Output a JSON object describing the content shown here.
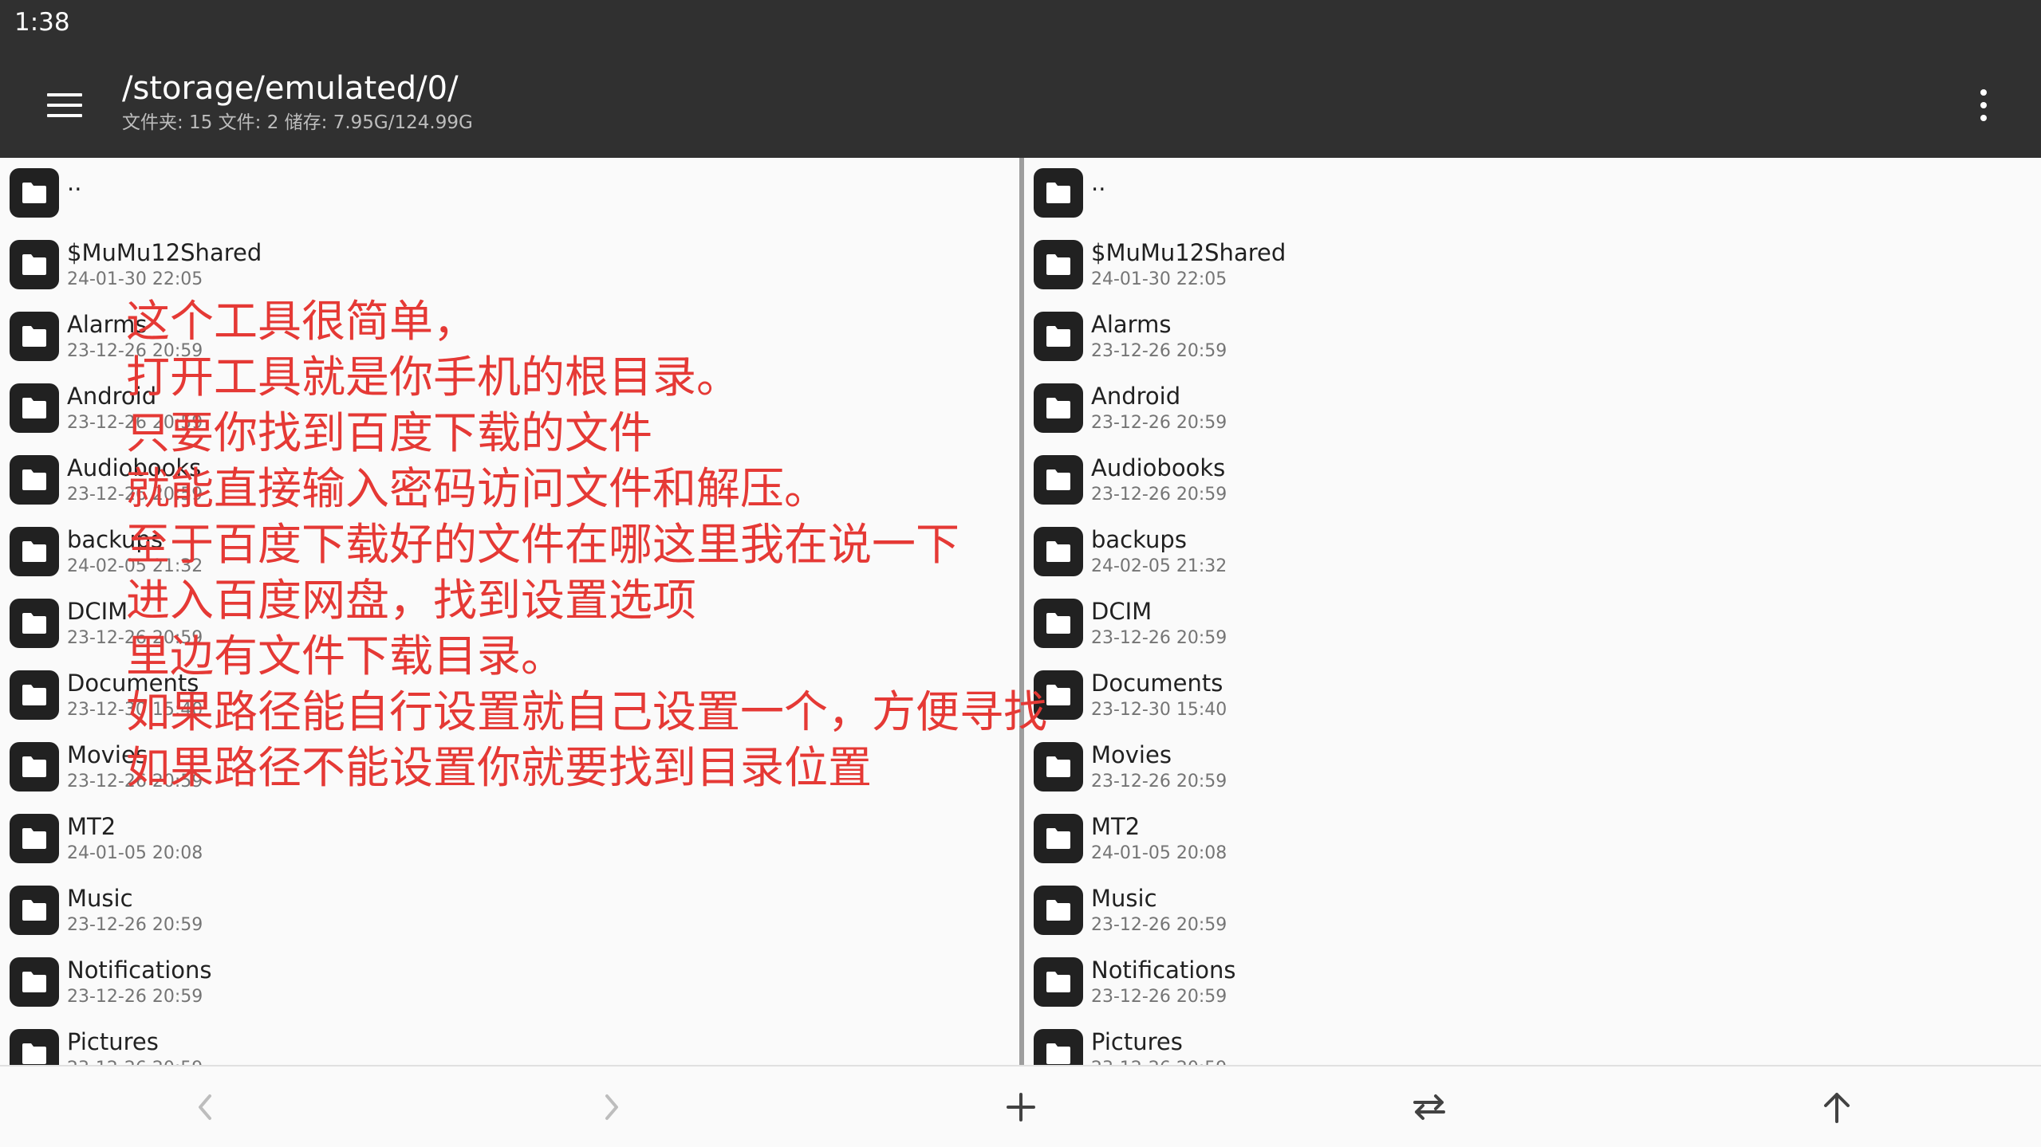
{
  "status_bar": {
    "time": "1:38"
  },
  "toolbar": {
    "path": "/storage/emulated/0/",
    "info": "文件夹: 15  文件: 2  储存: 7.95G/124.99G"
  },
  "left_pane": {
    "up_label": "..",
    "items": [
      {
        "name": "$MuMu12Shared",
        "date": "24-01-30 22:05"
      },
      {
        "name": "Alarms",
        "date": "23-12-26 20:59"
      },
      {
        "name": "Android",
        "date": "23-12-26 20:59"
      },
      {
        "name": "Audiobooks",
        "date": "23-12-26 20:59"
      },
      {
        "name": "backups",
        "date": "24-02-05 21:32"
      },
      {
        "name": "DCIM",
        "date": "23-12-26 20:59"
      },
      {
        "name": "Documents",
        "date": "23-12-30 15:40"
      },
      {
        "name": "Movies",
        "date": "23-12-26 20:59"
      },
      {
        "name": "MT2",
        "date": "24-01-05 20:08"
      },
      {
        "name": "Music",
        "date": "23-12-26 20:59"
      },
      {
        "name": "Notifications",
        "date": "23-12-26 20:59"
      },
      {
        "name": "Pictures",
        "date": "23-12-26 20:59"
      }
    ]
  },
  "right_pane": {
    "up_label": "..",
    "items": [
      {
        "name": "$MuMu12Shared",
        "date": "24-01-30 22:05"
      },
      {
        "name": "Alarms",
        "date": "23-12-26 20:59"
      },
      {
        "name": "Android",
        "date": "23-12-26 20:59"
      },
      {
        "name": "Audiobooks",
        "date": "23-12-26 20:59"
      },
      {
        "name": "backups",
        "date": "24-02-05 21:32"
      },
      {
        "name": "DCIM",
        "date": "23-12-26 20:59"
      },
      {
        "name": "Documents",
        "date": "23-12-30 15:40"
      },
      {
        "name": "Movies",
        "date": "23-12-26 20:59"
      },
      {
        "name": "MT2",
        "date": "24-01-05 20:08"
      },
      {
        "name": "Music",
        "date": "23-12-26 20:59"
      },
      {
        "name": "Notifications",
        "date": "23-12-26 20:59"
      },
      {
        "name": "Pictures",
        "date": "23-12-26 20:59"
      }
    ]
  },
  "annotation": {
    "color": "#e53935",
    "lines": [
      "这个工具很简单，",
      "打开工具就是你手机的根目录。",
      "只要你找到百度下载的文件",
      "就能直接输入密码访问文件和解压。",
      "至于百度下载好的文件在哪这里我在说一下",
      "进入百度网盘，找到设置选项",
      "里边有文件下载目录。",
      "如果路径能自行设置就自己设置一个，方便寻找",
      "如果路径不能设置你就要找到目录位置"
    ]
  },
  "bottom_bar": {
    "icons": [
      "back-icon",
      "forward-icon",
      "add-icon",
      "swap-icon",
      "up-arrow-icon"
    ]
  },
  "colors": {
    "bar_background": "#303030",
    "list_background": "#fafafa",
    "annotation_red": "#e53935"
  }
}
